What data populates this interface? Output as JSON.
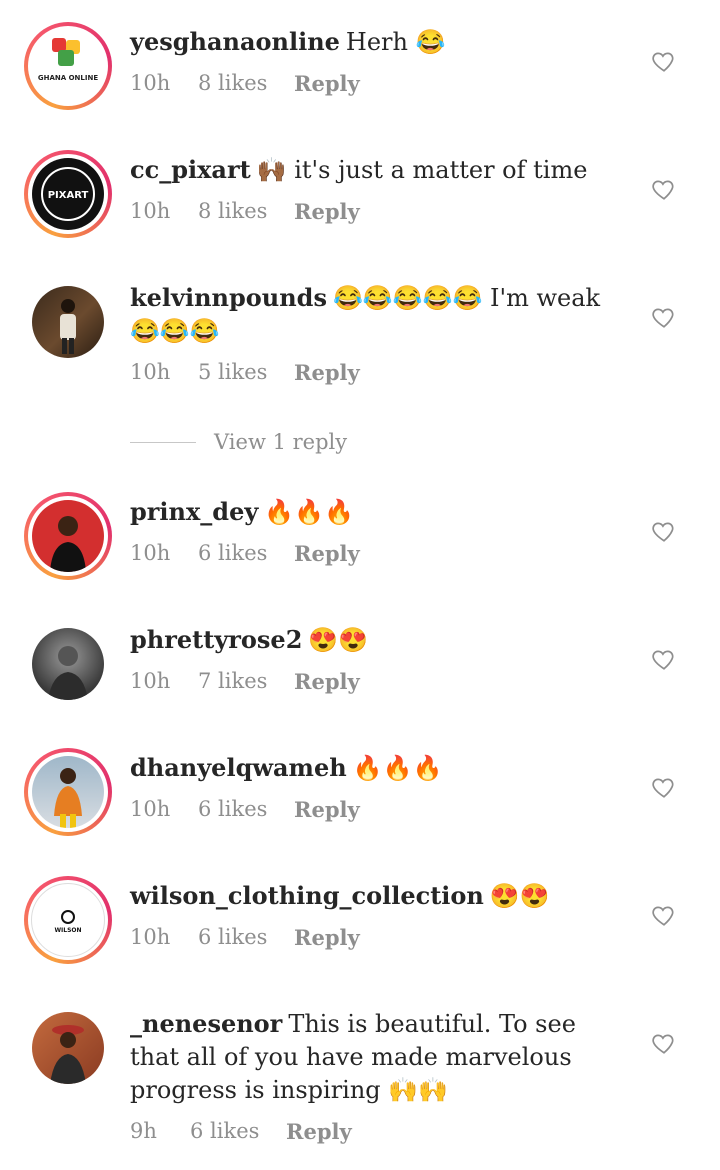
{
  "comments": [
    {
      "username": "yesghanaonline",
      "text": "Herh 😂",
      "time": "10h",
      "likes": "8 likes",
      "reply": "Reply",
      "avatar_text": "GHANA ONLINE",
      "ring": true
    },
    {
      "username": "cc_pixart",
      "text": "🙌🏾 it's just a matter of time",
      "time": "10h",
      "likes": "8 likes",
      "reply": "Reply",
      "avatar_text": "PIXART",
      "ring": true
    },
    {
      "username": "kelvinnpounds",
      "text": "😂😂😂😂😂 I'm weak 😂😂😂",
      "time": "10h",
      "likes": "5 likes",
      "reply": "Reply",
      "ring": false
    },
    {
      "username": "prinx_dey",
      "text": "🔥🔥🔥",
      "time": "10h",
      "likes": "6 likes",
      "reply": "Reply",
      "ring": true
    },
    {
      "username": "phrettyrose2",
      "text": "😍😍",
      "time": "10h",
      "likes": "7 likes",
      "reply": "Reply",
      "ring": false
    },
    {
      "username": "dhanyelqwameh",
      "text": "🔥🔥🔥",
      "time": "10h",
      "likes": "6 likes",
      "reply": "Reply",
      "ring": true
    },
    {
      "username": "wilson_clothing_collection",
      "text": "😍😍",
      "time": "10h",
      "likes": "6 likes",
      "reply": "Reply",
      "avatar_text": "WILSON",
      "ring": true
    },
    {
      "username": "_nenesenor",
      "text": "This is beautiful. To see that all of you have made marvelous progress is inspiring 🙌🙌",
      "time": "9h",
      "likes": "6 likes",
      "reply": "Reply",
      "ring": false
    }
  ],
  "view_replies": "View 1 reply",
  "icons": {
    "like": "heart-outline-icon"
  },
  "colors": {
    "ring_start": "#f9a03f",
    "ring_end": "#e1306c",
    "meta": "#8e8e8e",
    "text": "#262626"
  }
}
